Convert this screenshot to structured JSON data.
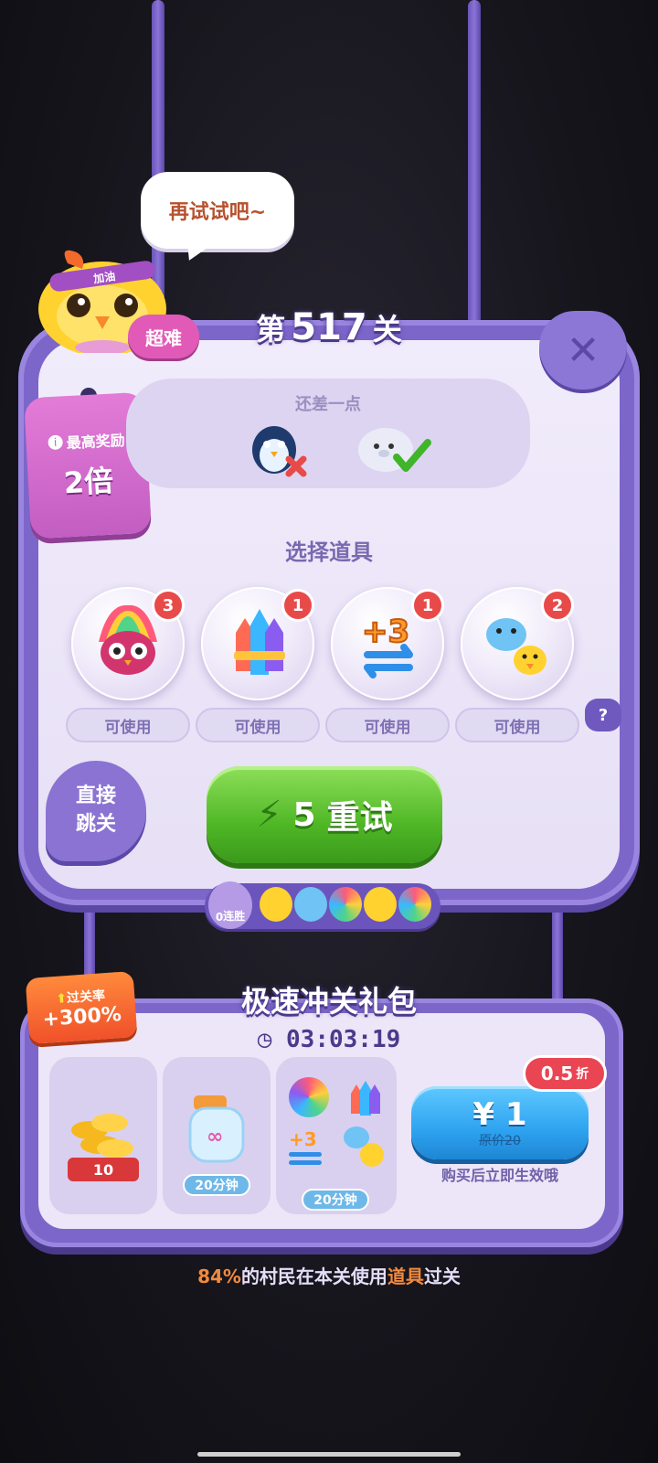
{
  "speech": "再试试吧~",
  "chick_headband": "加油",
  "level": {
    "prefix": "第",
    "number": "517",
    "suffix": "关",
    "difficulty": "超难"
  },
  "reward": {
    "label": "最高奖励",
    "value": "2倍"
  },
  "almost": {
    "title": "还差一点"
  },
  "items_section": {
    "title": "选择道具",
    "items": [
      {
        "icon": "rainbow-owl-icon",
        "count": "3",
        "status": "可使用"
      },
      {
        "icon": "rocket-icon",
        "count": "1",
        "status": "可使用"
      },
      {
        "icon": "plus-three-moves-icon",
        "count": "1",
        "status": "可使用"
      },
      {
        "icon": "hippo-chick-icon",
        "count": "2",
        "status": "可使用"
      }
    ],
    "help": "?"
  },
  "skip_button": {
    "line1": "直接",
    "line2": "跳关"
  },
  "retry_button": {
    "cost": "5",
    "label": "重试"
  },
  "streak": {
    "label": "连胜",
    "count": "0"
  },
  "gift_pack": {
    "title": "极速冲关礼包",
    "timer": "03:03:19",
    "pass_rate": {
      "label": "过关率",
      "value": "+300%"
    },
    "coins": "10",
    "bottle_time": "20分钟",
    "items_time": "20分钟",
    "items_plus": "+3",
    "price": "¥ 1",
    "original_price": "原价20",
    "discount": {
      "number": "0.5",
      "unit": "折"
    },
    "note": "购买后立即生效哦"
  },
  "footer": {
    "percent": "84%",
    "text1": "的村民在本关使用",
    "highlight": "道具",
    "text2": "过关"
  },
  "colors": {
    "panel": "#7d66c9",
    "panel_inner": "#f1ecfb",
    "retry_green": "#4fb726",
    "buy_blue": "#2ea3f0",
    "badge_red": "#e84a4a",
    "accent_orange": "#f28a3e"
  }
}
